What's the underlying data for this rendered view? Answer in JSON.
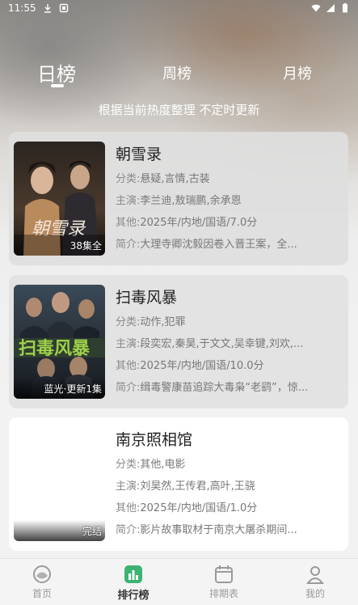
{
  "status_bar": {
    "time": "11:55"
  },
  "tabs": [
    {
      "label": "日榜",
      "active": true
    },
    {
      "label": "周榜",
      "active": false
    },
    {
      "label": "月榜",
      "active": false
    }
  ],
  "subtitle": "根据当前热度整理 不定时更新",
  "items": [
    {
      "title": "朝雪录",
      "badge": "38集全",
      "genre_label": "分类:",
      "genre": "悬疑,言情,古装",
      "cast_label": "主演:",
      "cast": "李兰迪,敖瑞鹏,余承恩",
      "other_label": "其他:",
      "other": "2025年/内地/国语/7.0分",
      "intro_label": "简介:",
      "intro": "大理寺卿沈毅因卷入晋王案，全..."
    },
    {
      "title": "扫毒风暴",
      "badge": "蓝光·更新1集",
      "genre_label": "分类:",
      "genre": "动作,犯罪",
      "cast_label": "主演:",
      "cast": "段奕宏,秦昊,于文文,吴幸键,刘欢,...",
      "other_label": "其他:",
      "other": "2025年/内地/国语/10.0分",
      "intro_label": "简介:",
      "intro": "缉毒警康苗追踪大毒枭“老鹞”，惊..."
    },
    {
      "title": "南京照相馆",
      "badge": "完结",
      "genre_label": "分类:",
      "genre": "其他,电影",
      "cast_label": "主演:",
      "cast": "刘昊然,王传君,高叶,王骁",
      "other_label": "其他:",
      "other": "2025年/内地/国语/1.0分",
      "intro_label": "简介:",
      "intro": "影片故事取材于南京大屠杀期间..."
    }
  ],
  "nav": [
    {
      "label": "首页",
      "icon": "home-icon",
      "active": false
    },
    {
      "label": "排行榜",
      "icon": "ranking-icon",
      "active": true
    },
    {
      "label": "排期表",
      "icon": "schedule-icon",
      "active": false
    },
    {
      "label": "我的",
      "icon": "profile-icon",
      "active": false
    }
  ],
  "colors": {
    "accent_green": "#3cb371",
    "text_dark": "#222222",
    "text_muted": "#777777"
  }
}
